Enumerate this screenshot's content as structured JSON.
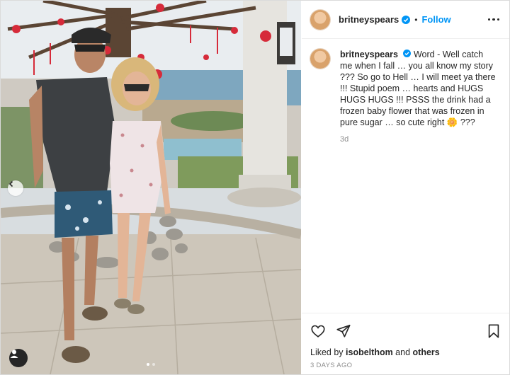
{
  "post": {
    "username": "britneyspears",
    "follow_label": "Follow",
    "caption": {
      "username": "britneyspears",
      "text": "Word - Well catch me when I fall … you all know my story ??? So go to Hell … I will meet ya there !!! Stupid poem … hearts and HUGS HUGS HUGS !!! PSSS the drink had a frozen baby flower that was frozen in pure sugar … so cute right",
      "emoji": "🌼",
      "suffix": " ???",
      "time_ago": "3d"
    },
    "likes": {
      "prefix": "Liked by ",
      "user": "isobelthom",
      "joiner": " and ",
      "others": "others"
    },
    "date": "3 DAYS AGO"
  },
  "carousel": {
    "dots": 2,
    "active": 1
  },
  "icons": {
    "verified": "verified-badge-icon",
    "more": "more-options-icon",
    "like": "heart-icon",
    "share": "send-icon",
    "save": "bookmark-icon",
    "prev": "chevron-left-icon",
    "tagged": "user-tag-icon"
  },
  "colors": {
    "accent": "#0095f6",
    "text": "#262626",
    "muted": "#8e8e8e"
  }
}
